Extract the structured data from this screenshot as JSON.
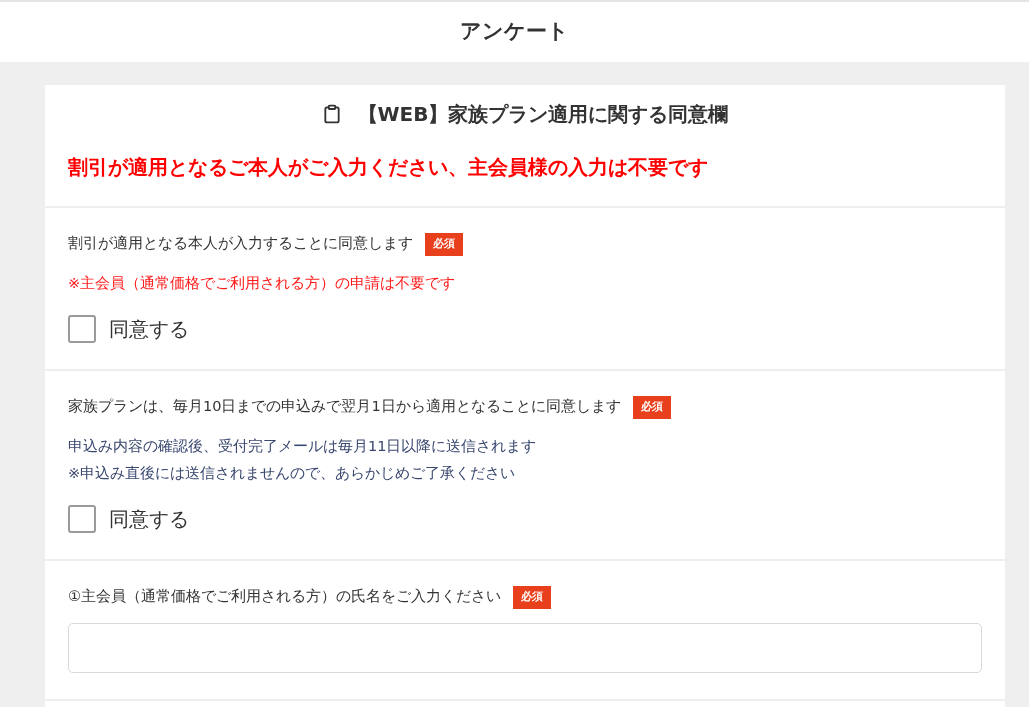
{
  "header": {
    "title": "アンケート"
  },
  "form": {
    "title": "【WEB】家族プラン適用に関する同意欄",
    "notice": "割引が適用となるご本人がご入力ください、主会員様の入力は不要です",
    "questions": [
      {
        "kind": "checkbox",
        "label": "割引が適用となる本人が入力することに同意します",
        "badge": "必須",
        "notes": [
          {
            "kind": "alert",
            "text": "※主会員（通常価格でご利用される方）の申請は不要です"
          }
        ],
        "option": {
          "label": "同意する",
          "checked": false
        }
      },
      {
        "kind": "checkbox",
        "label": "家族プランは、毎月10日までの申込みで翌月1日から適用となることに同意します",
        "badge": "必須",
        "notes": [
          {
            "kind": "info",
            "text": "申込み内容の確認後、受付完了メールは毎月11日以降に送信されます"
          },
          {
            "kind": "info",
            "text": "※申込み直後には送信されませんので、あらかじめご了承ください"
          }
        ],
        "option": {
          "label": "同意する",
          "checked": false
        }
      },
      {
        "kind": "text",
        "label": "①主会員（通常価格でご利用される方）の氏名をご入力ください",
        "badge": "必須"
      }
    ]
  }
}
